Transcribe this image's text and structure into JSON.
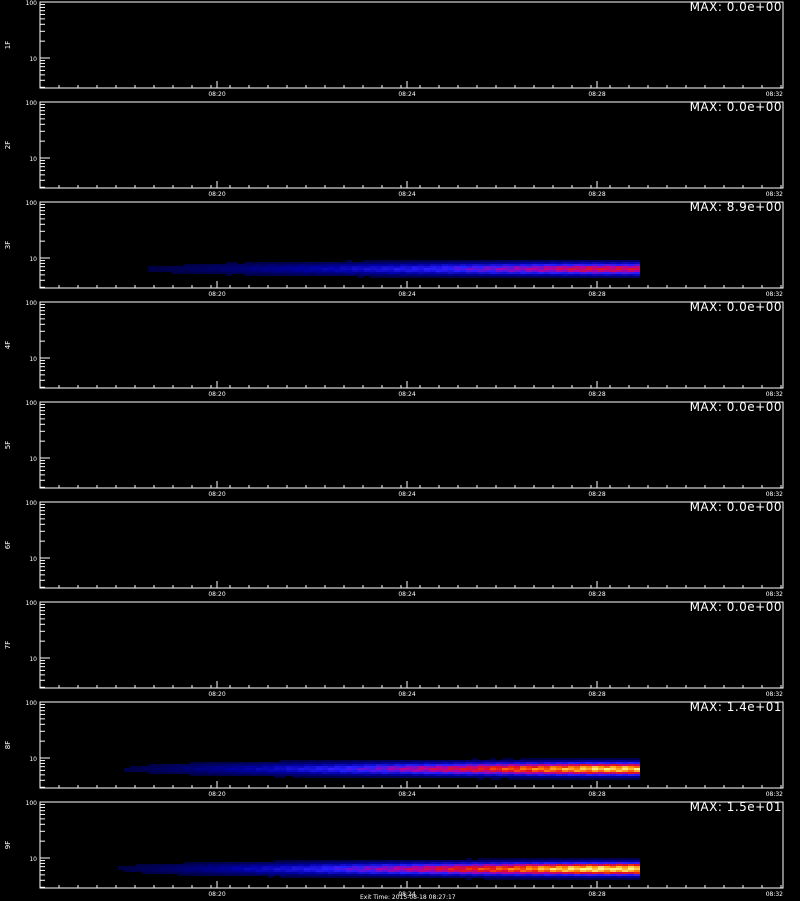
{
  "chart_data": {
    "type": "heatmap",
    "x_ticks": [
      "08:20",
      "08:24",
      "08:28",
      "08:32"
    ],
    "y_ticks": [
      "100",
      "10"
    ],
    "yscale": "log",
    "panels": [
      {
        "label": "1F",
        "max": "MAX: 0.0e+00",
        "intensity": 0
      },
      {
        "label": "2F",
        "max": "MAX: 0.0e+00",
        "intensity": 0
      },
      {
        "label": "3F",
        "max": "MAX: 8.9e+00",
        "intensity": 8.9
      },
      {
        "label": "4F",
        "max": "MAX: 0.0e+00",
        "intensity": 0
      },
      {
        "label": "5F",
        "max": "MAX: 0.0e+00",
        "intensity": 0
      },
      {
        "label": "6F",
        "max": "MAX: 0.0e+00",
        "intensity": 0
      },
      {
        "label": "7F",
        "max": "MAX: 0.0e+00",
        "intensity": 0
      },
      {
        "label": "8F",
        "max": "MAX: 1.4e+01",
        "intensity": 14
      },
      {
        "label": "9F",
        "max": "MAX: 1.5e+01",
        "intensity": 15
      }
    ],
    "bottom_caption": "Exit Time: 2015-08-18 08:27:17"
  }
}
